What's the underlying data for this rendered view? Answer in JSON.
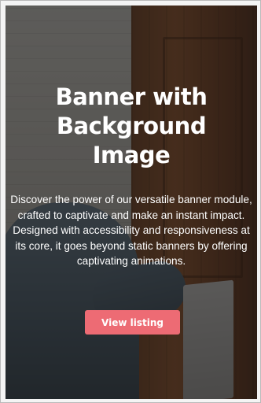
{
  "banner": {
    "title_lines": [
      "Banner with",
      "Background",
      "Image"
    ],
    "description": "Discover the power of our versatile banner module, crafted to captivate and make an instant impact. Designed with accessibility and responsiveness at its core, it goes beyond static banners by offering captivating animations.",
    "cta_label": "View listing"
  },
  "colors": {
    "cta_background": "#ed6b74",
    "text": "#ffffff",
    "overlay": "#12100e"
  }
}
